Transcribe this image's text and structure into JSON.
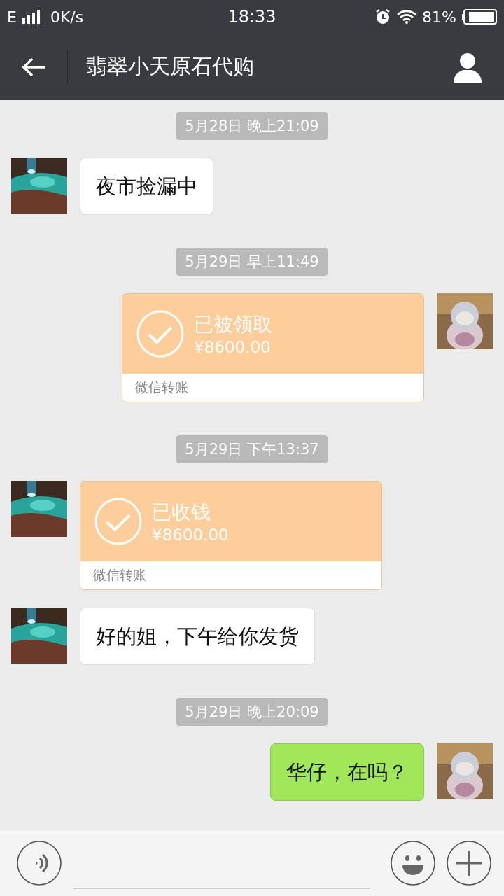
{
  "status_bar": {
    "network": "E",
    "speed": "0K/s",
    "time": "18:33",
    "battery": "81%"
  },
  "header": {
    "title": "翡翠小天原石代购"
  },
  "messages": [
    {
      "kind": "time",
      "text": "5月28日 晚上21:09"
    },
    {
      "kind": "text",
      "mine": false,
      "text": "夜市捡漏中"
    },
    {
      "kind": "time",
      "text": "5月29日 早上11:49"
    },
    {
      "kind": "transfer",
      "mine": true,
      "status": "已被领取",
      "amount": "¥8600.00",
      "footer": "微信转账"
    },
    {
      "kind": "time",
      "text": "5月29日 下午13:37"
    },
    {
      "kind": "transfer",
      "mine": false,
      "status": "已收钱",
      "amount": "¥8600.00",
      "footer": "微信转账"
    },
    {
      "kind": "text",
      "mine": false,
      "text": "好的姐，下午给你发货"
    },
    {
      "kind": "time",
      "text": "5月29日 晚上20:09"
    },
    {
      "kind": "text",
      "mine": true,
      "text": "华仔，在吗？"
    }
  ]
}
